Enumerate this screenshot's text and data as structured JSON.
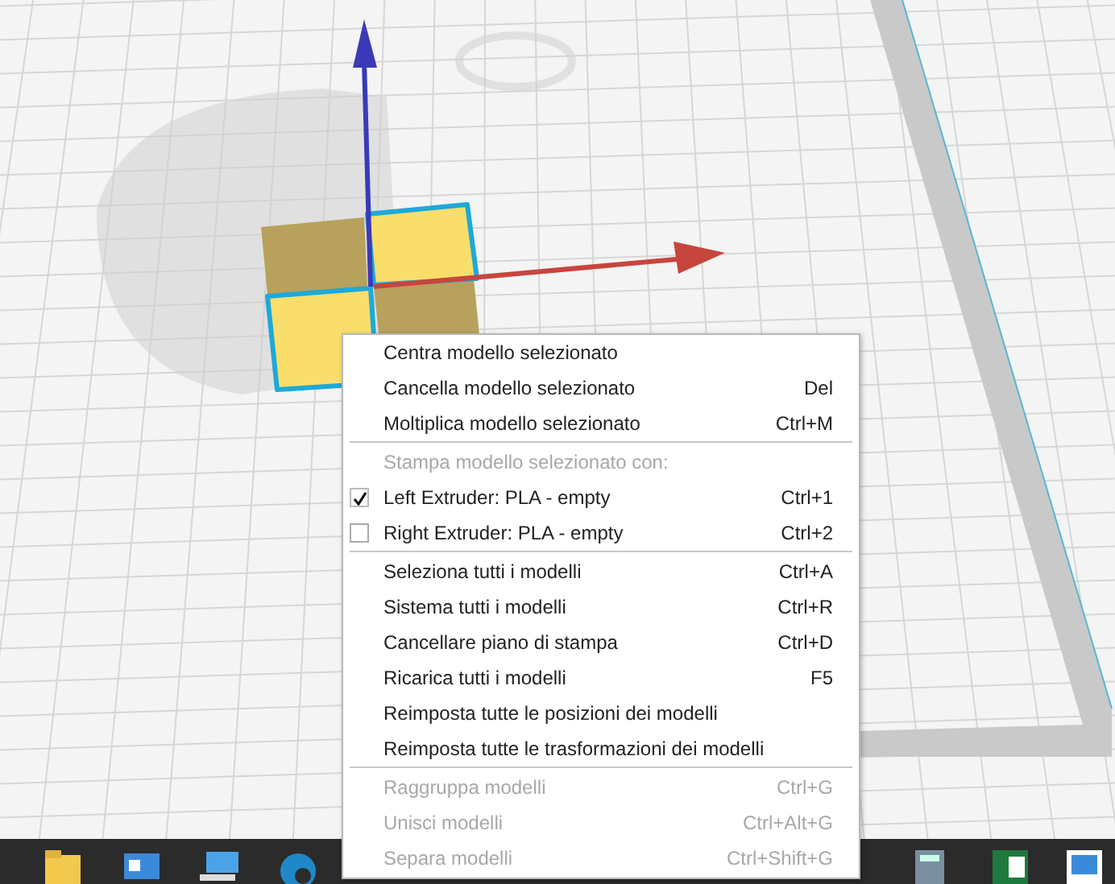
{
  "context_menu": {
    "items": [
      {
        "kind": "item",
        "label": "Centra modello selezionato",
        "disabled": false
      },
      {
        "kind": "item",
        "label": "Cancella modello selezionato",
        "shortcut": "Del",
        "disabled": false
      },
      {
        "kind": "item",
        "label": "Moltiplica modello selezionato",
        "shortcut": "Ctrl+M",
        "disabled": false
      },
      {
        "kind": "separator"
      },
      {
        "kind": "header",
        "label": "Stampa modello selezionato con:"
      },
      {
        "kind": "check",
        "label": "Left Extruder: PLA - empty",
        "shortcut": "Ctrl+1",
        "checked": true
      },
      {
        "kind": "check",
        "label": "Right Extruder: PLA - empty",
        "shortcut": "Ctrl+2",
        "checked": false
      },
      {
        "kind": "separator"
      },
      {
        "kind": "item",
        "label": "Seleziona tutti i modelli",
        "shortcut": "Ctrl+A",
        "disabled": false
      },
      {
        "kind": "item",
        "label": "Sistema tutti i modelli",
        "shortcut": "Ctrl+R",
        "disabled": false
      },
      {
        "kind": "item",
        "label": "Cancellare piano di stampa",
        "shortcut": "Ctrl+D",
        "disabled": false
      },
      {
        "kind": "item",
        "label": "Ricarica tutti i modelli",
        "shortcut": "F5",
        "disabled": false
      },
      {
        "kind": "item",
        "label": "Reimposta tutte le posizioni dei modelli",
        "disabled": false
      },
      {
        "kind": "item",
        "label": "Reimposta tutte le trasformazioni dei modelli",
        "disabled": false
      },
      {
        "kind": "separator"
      },
      {
        "kind": "item",
        "label": "Raggruppa modelli",
        "shortcut": "Ctrl+G",
        "disabled": true
      },
      {
        "kind": "item",
        "label": "Unisci modelli",
        "shortcut": "Ctrl+Alt+G",
        "disabled": true
      },
      {
        "kind": "item",
        "label": "Separa modelli",
        "shortcut": "Ctrl+Shift+G",
        "disabled": true
      }
    ]
  }
}
